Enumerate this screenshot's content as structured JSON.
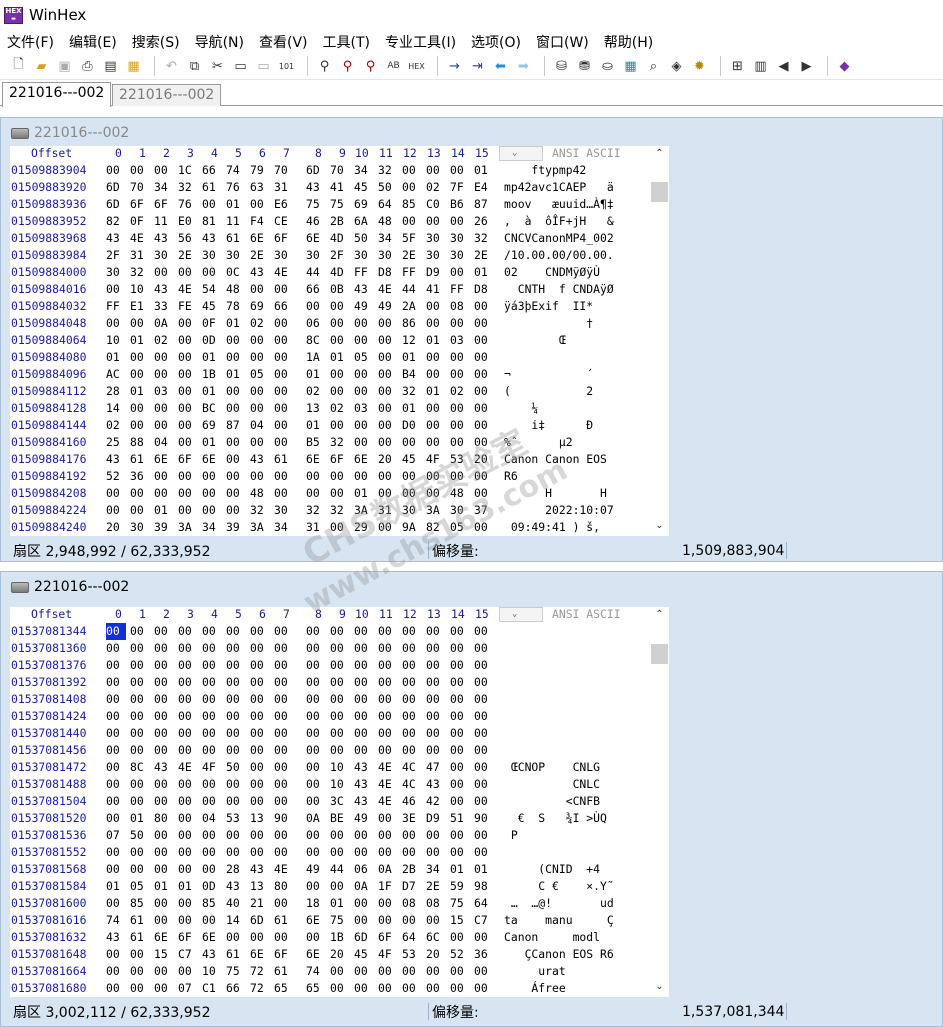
{
  "app": {
    "title": "WinHex",
    "logo_text": "HEX"
  },
  "menu": [
    "文件(F)",
    "编辑(E)",
    "搜索(S)",
    "导航(N)",
    "查看(V)",
    "工具(T)",
    "专业工具(I)",
    "选项(O)",
    "窗口(W)",
    "帮助(H)"
  ],
  "toolbar_icons": [
    "new-file-icon",
    "open-file-icon",
    "save-icon",
    "print-icon",
    "properties-icon",
    "open-folder-icon",
    "undo-icon",
    "copy-icon",
    "cut-icon",
    "paste-icon",
    "paste-new-icon",
    "write-icon",
    "find-icon",
    "find-replace-icon",
    "find-hex-icon",
    "replace-text-icon",
    "replace-hex-icon",
    "goto-offset-icon",
    "goto-sector-icon",
    "back-icon",
    "forward-icon",
    "disk-icon",
    "ram-icon",
    "clone-icon",
    "calculator-icon",
    "search-icon",
    "refresh-icon",
    "settings-icon",
    "grid-icon",
    "table-icon",
    "prev-icon",
    "next-icon",
    "book-icon"
  ],
  "tabs": [
    "221016---002",
    "221016---002"
  ],
  "hex_header": {
    "offset": "Offset",
    "cols": [
      "0",
      "1",
      "2",
      "3",
      "4",
      "5",
      "6",
      "7",
      "8",
      "9",
      "10",
      "11",
      "12",
      "13",
      "14",
      "15"
    ],
    "ascii": "ANSI ASCII",
    "sort": "⌄"
  },
  "pane1": {
    "title": "221016---002",
    "rows": [
      [
        "01509883904",
        "00 00 00 1C 66 74 79 70 6D 70 34 32 00 00 00 01",
        "    ftypmp42    "
      ],
      [
        "01509883920",
        "6D 70 34 32 61 76 63 31 43 41 45 50 00 02 7F E4",
        "mp42avc1CAEP   ä"
      ],
      [
        "01509883936",
        "6D 6F 6F 76 00 01 00 E6 75 75 69 64 85 C0 B6 87",
        "moov   æuuid…À¶‡"
      ],
      [
        "01509883952",
        "82 0F 11 E0 81 11 F4 CE 46 2B 6A 48 00 00 00 26",
        ",  à  ôÎF+jH   &"
      ],
      [
        "01509883968",
        "43 4E 43 56 43 61 6E 6F 6E 4D 50 34 5F 30 30 32",
        "CNCVCanonMP4_002"
      ],
      [
        "01509883984",
        "2F 31 30 2E 30 30 2E 30 30 2F 30 30 2E 30 30 2E",
        "/10.00.00/00.00."
      ],
      [
        "01509884000",
        "30 32 00 00 00 0C 43 4E 44 4D FF D8 FF D9 00 01",
        "02    CNDMÿØÿÙ  "
      ],
      [
        "01509884016",
        "00 10 43 4E 54 48 00 00 66 0B 43 4E 44 41 FF D8",
        "  CNTH  f CNDAÿØ"
      ],
      [
        "01509884032",
        "FF E1 33 FE 45 78 69 66 00 00 49 49 2A 00 08 00",
        "ÿá3þExif  II*   "
      ],
      [
        "01509884048",
        "00 00 0A 00 0F 01 02 00 06 00 00 00 86 00 00 00",
        "            †   "
      ],
      [
        "01509884064",
        "10 01 02 00 0D 00 00 00 8C 00 00 00 12 01 03 00",
        "        Œ       "
      ],
      [
        "01509884080",
        "01 00 00 00 01 00 00 00 1A 01 05 00 01 00 00 00",
        "                "
      ],
      [
        "01509884096",
        "AC 00 00 00 1B 01 05 00 01 00 00 00 B4 00 00 00",
        "¬           ´   "
      ],
      [
        "01509884112",
        "28 01 03 00 01 00 00 00 02 00 00 00 32 01 02 00",
        "(           2   "
      ],
      [
        "01509884128",
        "14 00 00 00 BC 00 00 00 13 02 03 00 01 00 00 00",
        "    ¼           "
      ],
      [
        "01509884144",
        "02 00 00 00 69 87 04 00 01 00 00 00 D0 00 00 00",
        "    i‡      Ð   "
      ],
      [
        "01509884160",
        "25 88 04 00 01 00 00 00 B5 32 00 00 00 00 00 00",
        "%ˆ      µ2      "
      ],
      [
        "01509884176",
        "43 61 6E 6F 6E 00 43 61 6E 6F 6E 20 45 4F 53 20",
        "Canon Canon EOS "
      ],
      [
        "01509884192",
        "52 36 00 00 00 00 00 00 00 00 00 00 00 00 00 00",
        "R6              "
      ],
      [
        "01509884208",
        "00 00 00 00 00 00 48 00 00 00 01 00 00 00 48 00",
        "      H       H "
      ],
      [
        "01509884224",
        "00 00 01 00 00 00 32 30 32 32 3A 31 30 3A 30 37",
        "      2022:10:07"
      ],
      [
        "01509884240",
        "20 30 39 3A 34 39 3A 34 31 00 29 00 9A 82 05 00",
        " 09:49:41 ) š,  "
      ]
    ],
    "status": {
      "sector": "扇区 2,948,992 / 62,333,952",
      "offset_label": "偏移量:",
      "offset_value": "1,509,883,904"
    }
  },
  "pane2": {
    "title": "221016---002",
    "rows": [
      [
        "01537081344",
        "00 00 00 00 00 00 00 00 00 00 00 00 00 00 00 00",
        "                "
      ],
      [
        "01537081360",
        "00 00 00 00 00 00 00 00 00 00 00 00 00 00 00 00",
        "                "
      ],
      [
        "01537081376",
        "00 00 00 00 00 00 00 00 00 00 00 00 00 00 00 00",
        "                "
      ],
      [
        "01537081392",
        "00 00 00 00 00 00 00 00 00 00 00 00 00 00 00 00",
        "                "
      ],
      [
        "01537081408",
        "00 00 00 00 00 00 00 00 00 00 00 00 00 00 00 00",
        "                "
      ],
      [
        "01537081424",
        "00 00 00 00 00 00 00 00 00 00 00 00 00 00 00 00",
        "                "
      ],
      [
        "01537081440",
        "00 00 00 00 00 00 00 00 00 00 00 00 00 00 00 00",
        "                "
      ],
      [
        "01537081456",
        "00 00 00 00 00 00 00 00 00 00 00 00 00 00 00 00",
        "                "
      ],
      [
        "01537081472",
        "00 8C 43 4E 4F 50 00 00 00 10 43 4E 4C 47 00 00",
        " ŒCNOP    CNLG  "
      ],
      [
        "01537081488",
        "00 00 00 00 00 00 00 00 00 10 43 4E 4C 43 00 00",
        "          CNLC  "
      ],
      [
        "01537081504",
        "00 00 00 00 00 00 00 00 00 3C 43 4E 46 42 00 00",
        "         <CNFB  "
      ],
      [
        "01537081520",
        "00 01 80 00 04 53 13 90 0A BE 49 00 3E D9 51 90",
        "  €  S   ¾I >ÙQ "
      ],
      [
        "01537081536",
        "07 50 00 00 00 00 00 00 00 00 00 00 00 00 00 00",
        " P              "
      ],
      [
        "01537081552",
        "00 00 00 00 00 00 00 00 00 00 00 00 00 00 00 00",
        "                "
      ],
      [
        "01537081568",
        "00 00 00 00 00 28 43 4E 49 44 06 0A 2B 34 01 01",
        "     (CNID  +4  "
      ],
      [
        "01537081584",
        "01 05 01 01 0D 43 13 80 00 00 0A 1F D7 2E 59 98",
        "     C €    ×.Y˜"
      ],
      [
        "01537081600",
        "00 85 00 00 85 40 21 00 18 01 00 00 08 08 75 64",
        " …  …@!       ud"
      ],
      [
        "01537081616",
        "74 61 00 00 00 14 6D 61 6E 75 00 00 00 00 15 C7",
        "ta    manu     Ç"
      ],
      [
        "01537081632",
        "43 61 6E 6F 6E 00 00 00 00 1B 6D 6F 64 6C 00 00",
        "Canon     modl  "
      ],
      [
        "01537081648",
        "00 00 15 C7 43 61 6E 6F 6E 20 45 4F 53 20 52 36",
        "   ÇCanon EOS R6"
      ],
      [
        "01537081664",
        "00 00 00 00 10 75 72 61 74 00 00 00 00 00 00 00",
        "     urat       "
      ],
      [
        "01537081680",
        "00 00 00 07 C1 66 72 65 65 00 00 00 00 00 00 00",
        "    Áfree       "
      ]
    ],
    "status": {
      "sector": "扇区 3,002,112 / 62,333,952",
      "offset_label": "偏移量:",
      "offset_value": "1,537,081,344"
    }
  },
  "watermark": {
    "line1": "CHS数据实验室",
    "line2": "www.chs163.com"
  }
}
